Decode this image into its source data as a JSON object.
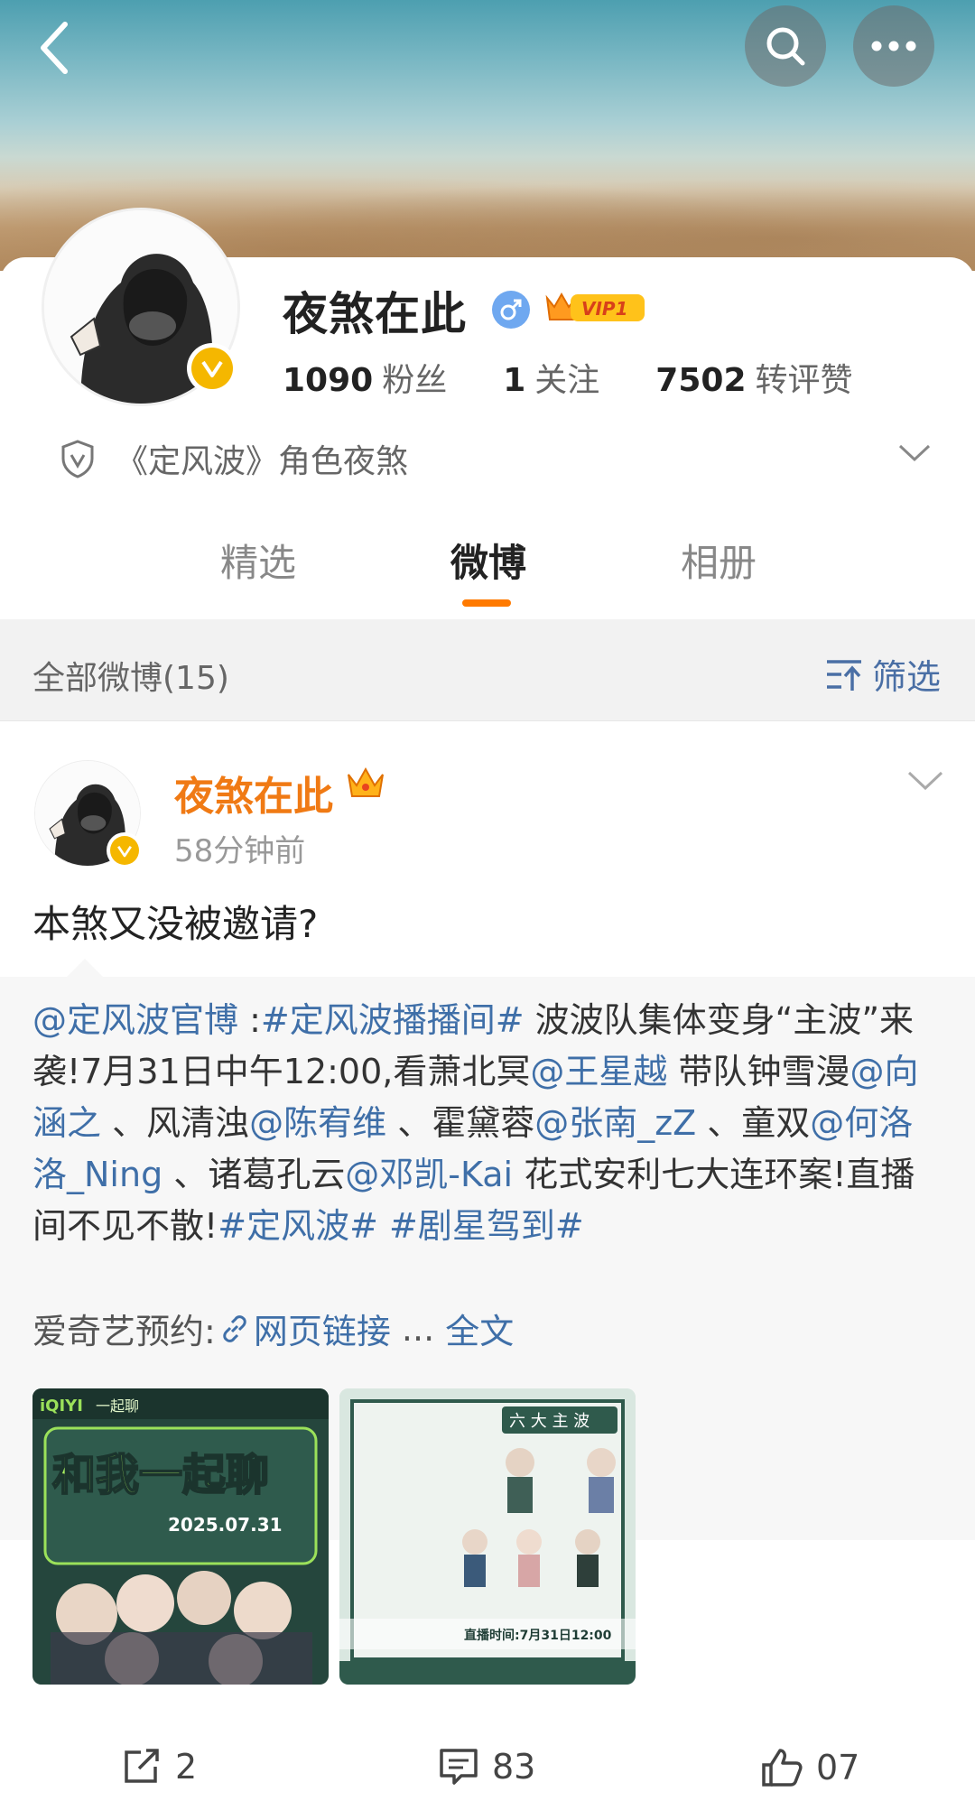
{
  "profile": {
    "name": "夜煞在此",
    "vip_label": "VIP1",
    "stats": [
      {
        "value": "1090",
        "label": "粉丝"
      },
      {
        "value": "1",
        "label": "关注"
      },
      {
        "value": "7502",
        "label": "转评赞"
      }
    ],
    "description": "《定风波》角色夜煞"
  },
  "tabs": [
    {
      "label": "精选",
      "active": false
    },
    {
      "label": "微博",
      "active": true
    },
    {
      "label": "相册",
      "active": false
    }
  ],
  "filter": {
    "count_label": "全部微博(15)",
    "filter_label": "筛选"
  },
  "post": {
    "author": "夜煞在此",
    "time": "58分钟前",
    "text": "本煞又没被邀请?",
    "repost": {
      "segments": [
        {
          "t": "@定风波官博",
          "link": true
        },
        {
          "t": " :",
          "link": false
        },
        {
          "t": "#定风波播播间#",
          "link": true
        },
        {
          "t": " 波波队集体变身“主波”来袭!7月31日中午12:00,看萧北冥",
          "link": false
        },
        {
          "t": "@王星越",
          "link": true
        },
        {
          "t": " 带队钟雪漫",
          "link": false
        },
        {
          "t": "@向涵之",
          "link": true
        },
        {
          "t": " 、风清浊",
          "link": false
        },
        {
          "t": "@陈宥维",
          "link": true
        },
        {
          "t": " 、霍黛蓉",
          "link": false
        },
        {
          "t": "@张南_zZ",
          "link": true
        },
        {
          "t": " 、童双",
          "link": false
        },
        {
          "t": "@何洛洛_Ning",
          "link": true
        },
        {
          "t": " 、诸葛孔云",
          "link": false
        },
        {
          "t": "@邓凯-Kai",
          "link": true
        },
        {
          "t": " 花式安利七大连环案!直播间不见不散!",
          "link": false
        },
        {
          "t": "#定风波#",
          "link": true
        },
        {
          "t": " ",
          "link": false
        },
        {
          "t": "#剧星驾到#",
          "link": true
        }
      ],
      "meta_prefix": "爱奇艺预约:",
      "meta_link": "网页链接",
      "meta_ellipsis": " ... ",
      "meta_more": "全文"
    },
    "images": [
      {
        "brand": "iQIYI",
        "sub": "一起聊",
        "headline": "和我一起聊",
        "date": "2025.07.31"
      },
      {
        "header": "六 大 主 波",
        "caption": "直播时间:7月31日12:00"
      }
    ],
    "actions": {
      "repost_count": "2",
      "comment_count": "83",
      "like_count": "07"
    }
  },
  "colors": {
    "accent_orange": "#ff7a00",
    "name_orange": "#f07a14",
    "link_blue": "#3f6fa8",
    "verified_gold": "#f5b700"
  }
}
